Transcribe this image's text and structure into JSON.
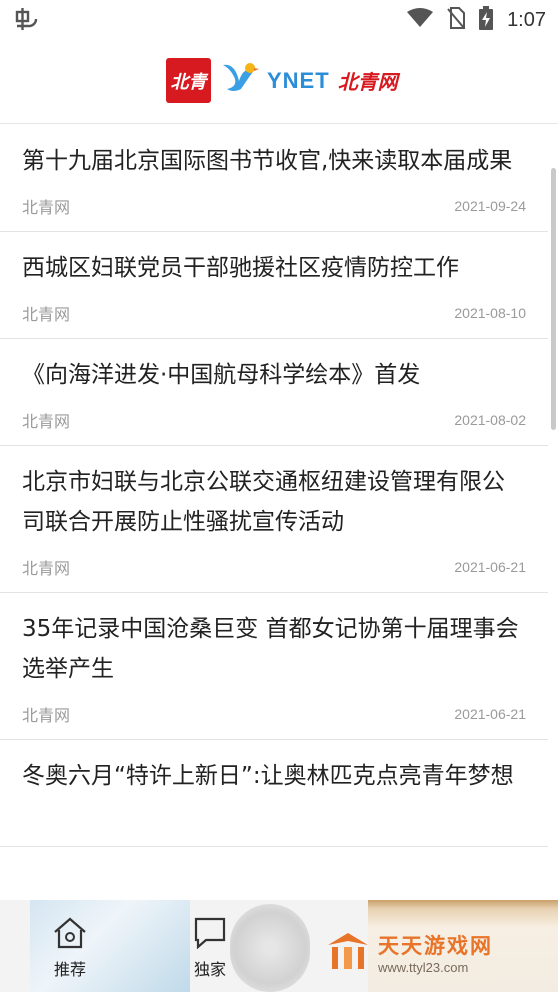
{
  "status_bar": {
    "time": "1:07",
    "left_icon": "bug-icon",
    "icons": [
      "wifi-icon",
      "no-sim-icon",
      "battery-charging-icon"
    ]
  },
  "header": {
    "logo_box_text": "北青",
    "logo_ynet": "YNET",
    "logo_script": "北青网"
  },
  "news": [
    {
      "title": "第十九届北京国际图书节收官,快来读取本届成果",
      "source": "北青网",
      "date": "2021-09-24"
    },
    {
      "title": "西城区妇联党员干部驰援社区疫情防控工作",
      "source": "北青网",
      "date": "2021-08-10"
    },
    {
      "title": "《向海洋进发·中国航母科学绘本》首发",
      "source": "北青网",
      "date": "2021-08-02"
    },
    {
      "title": "北京市妇联与北京公联交通枢纽建设管理有限公司联合开展防止性骚扰宣传活动",
      "source": "北青网",
      "date": "2021-06-21"
    },
    {
      "title": "35年记录中国沧桑巨变 首都女记协第十届理事会选举产生",
      "source": "北青网",
      "date": "2021-06-21"
    },
    {
      "title": "冬奥六月“特许上新日”:让奥林匹克点亮青年梦想",
      "source": "",
      "date": ""
    }
  ],
  "bottom_nav": {
    "tabs": [
      {
        "label": "推荐",
        "icon": "home-icon"
      },
      {
        "label": "独家",
        "icon": "chat-bubble-icon"
      }
    ]
  },
  "watermark": {
    "name": "天天游戏网",
    "url": "www.ttyl23.com"
  },
  "colors": {
    "brand_red": "#d71920",
    "ynet_blue": "#2d8ed8",
    "watermark_orange": "#e8742a"
  }
}
